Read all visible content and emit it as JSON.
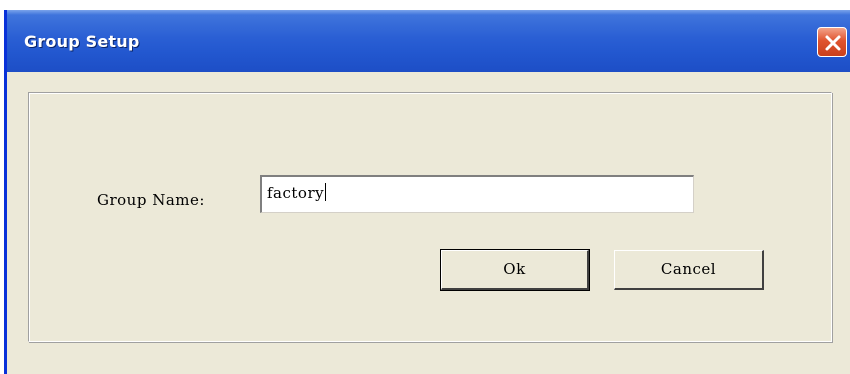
{
  "window": {
    "title": "Group Setup",
    "close_icon": "close-icon"
  },
  "form": {
    "group_name_label": "Group Name:",
    "group_name_value": "factory"
  },
  "buttons": {
    "ok_label": "Ok",
    "cancel_label": "Cancel"
  },
  "colors": {
    "titlebar": "#2257cf",
    "dialog_bg": "#ece9d8",
    "close_button": "#e0542f"
  }
}
